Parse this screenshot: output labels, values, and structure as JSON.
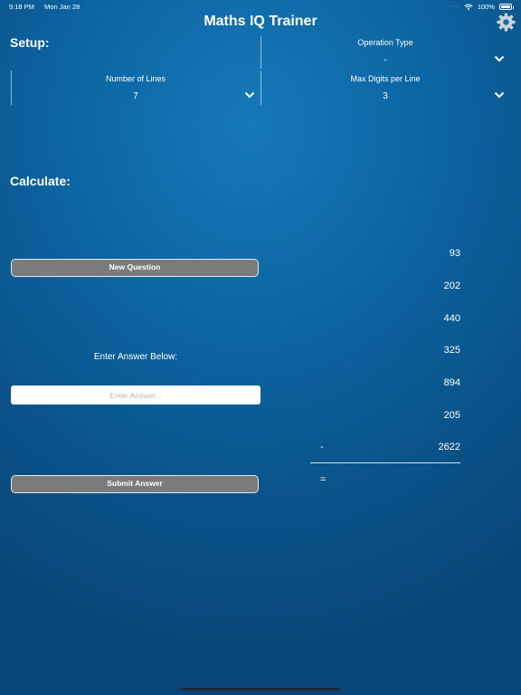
{
  "status_bar": {
    "time": "9:18 PM",
    "date": "Mon Jan 28",
    "battery": "100%"
  },
  "app": {
    "title": "Maths IQ Trainer"
  },
  "setup": {
    "label": "Setup:",
    "operation_type": {
      "label": "Operation Type",
      "value": "-"
    },
    "number_of_lines": {
      "label": "Number of Lines",
      "value": "7"
    },
    "max_digits": {
      "label": "Max Digits per Line",
      "value": "3"
    }
  },
  "calculate": {
    "label": "Calculate:",
    "new_question_label": "New Question",
    "prompt": "Enter Answer Below:",
    "answer_placeholder": "Enter Answer...",
    "submit_label": "Submit Answer",
    "numbers": [
      "93",
      "202",
      "440",
      "325",
      "894",
      "205",
      "2622"
    ],
    "operator": "-",
    "equals": "="
  },
  "icons": {
    "settings": "gear-icon",
    "picker": "chevron-down-icon",
    "wifi": "wifi-icon",
    "battery": "battery-icon"
  }
}
